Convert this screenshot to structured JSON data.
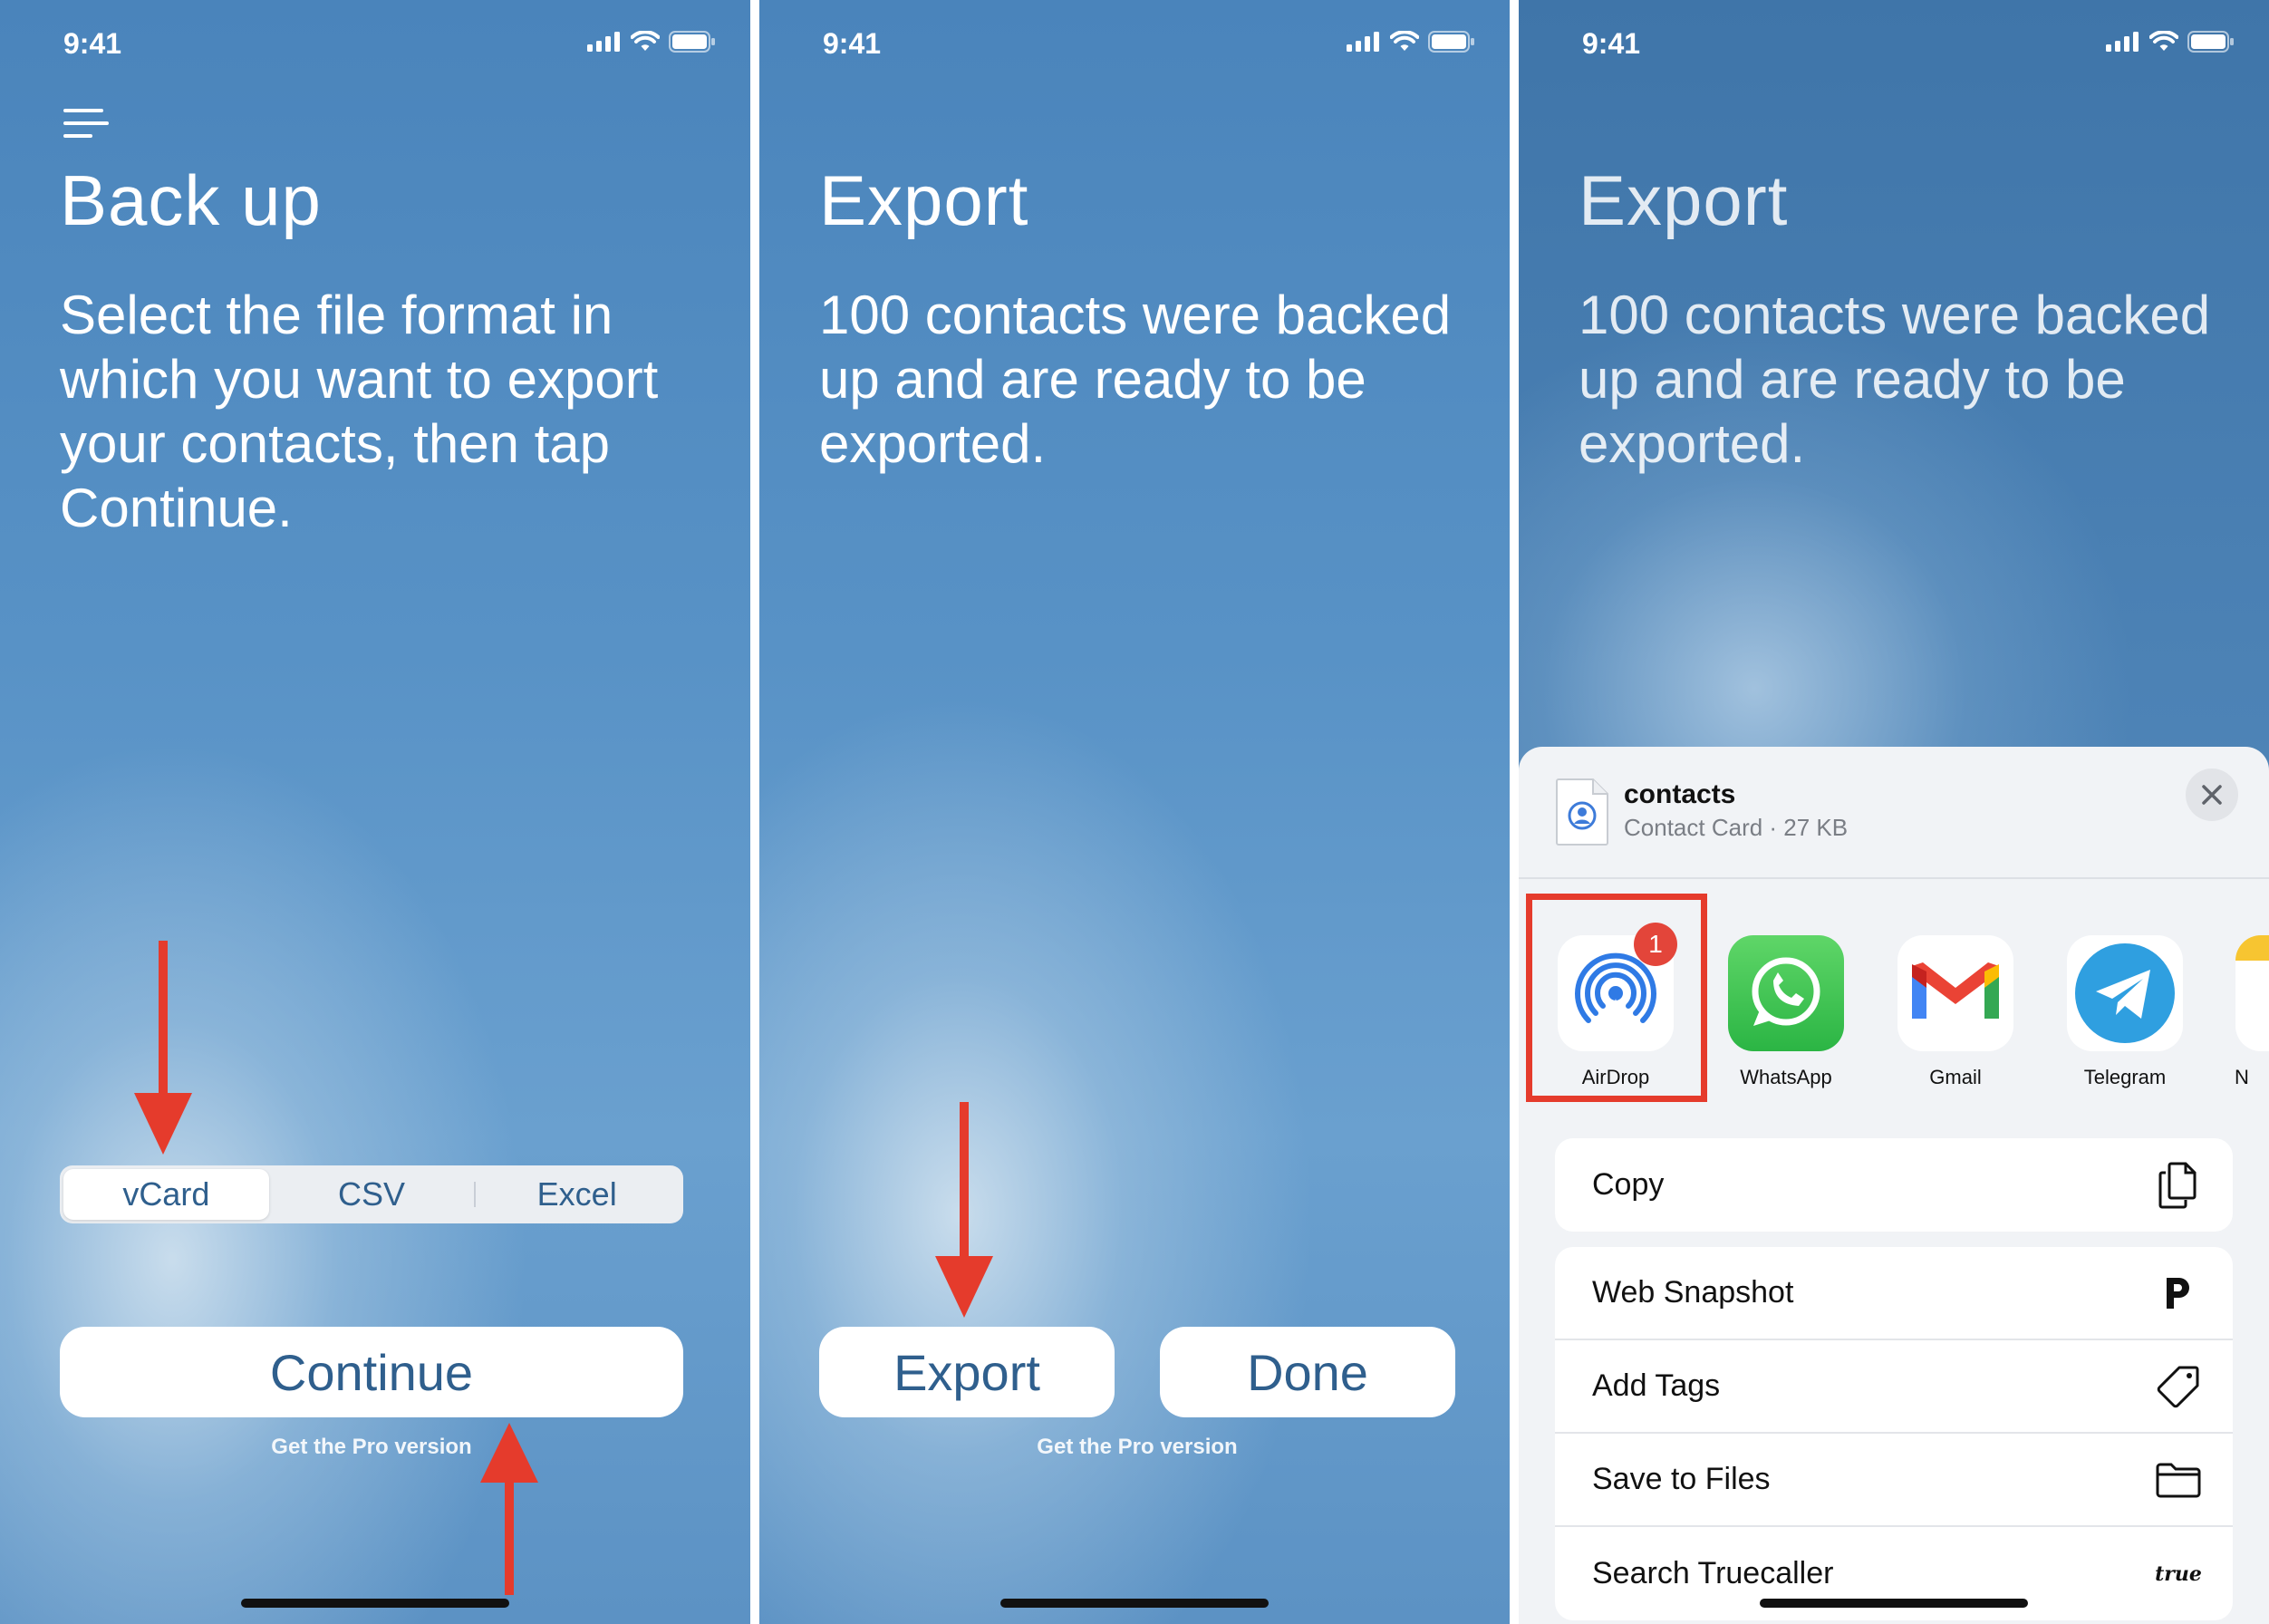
{
  "status": {
    "time": "9:41"
  },
  "screen1": {
    "title": "Back up",
    "description": "Select the file format in which you want to export your contacts, then tap Continue.",
    "segments": [
      "vCard",
      "CSV",
      "Excel"
    ],
    "selected_segment": "vCard",
    "continue_label": "Continue",
    "pro_link": "Get the Pro version"
  },
  "screen2": {
    "title": "Export",
    "description": "100 contacts were backed up and are ready to be exported.",
    "export_label": "Export",
    "done_label": "Done",
    "pro_link": "Get the Pro version"
  },
  "screen3": {
    "title": "Export",
    "description": "100 contacts were backed up and are ready to be exported.",
    "share_sheet": {
      "file_name": "contacts",
      "file_meta": "Contact Card · 27 KB",
      "apps": [
        {
          "label": "AirDrop",
          "icon": "airdrop-icon",
          "badge": "1"
        },
        {
          "label": "WhatsApp",
          "icon": "whatsapp-icon"
        },
        {
          "label": "Gmail",
          "icon": "gmail-icon"
        },
        {
          "label": "Telegram",
          "icon": "telegram-icon"
        },
        {
          "label": "N",
          "icon": "notes-icon"
        }
      ],
      "actions_primary": [
        {
          "label": "Copy",
          "icon": "copy-icon"
        }
      ],
      "actions": [
        {
          "label": "Web Snapshot",
          "icon": "web-snapshot-icon"
        },
        {
          "label": "Add Tags",
          "icon": "tag-icon"
        },
        {
          "label": "Save to Files",
          "icon": "folder-icon"
        },
        {
          "label": "Search Truecaller",
          "icon": "truecaller-icon",
          "icon_text": "true"
        }
      ]
    }
  },
  "colors": {
    "accent": "#2f5f8d",
    "arrow": "#e53b2c",
    "highlight": "#e53b2c"
  }
}
